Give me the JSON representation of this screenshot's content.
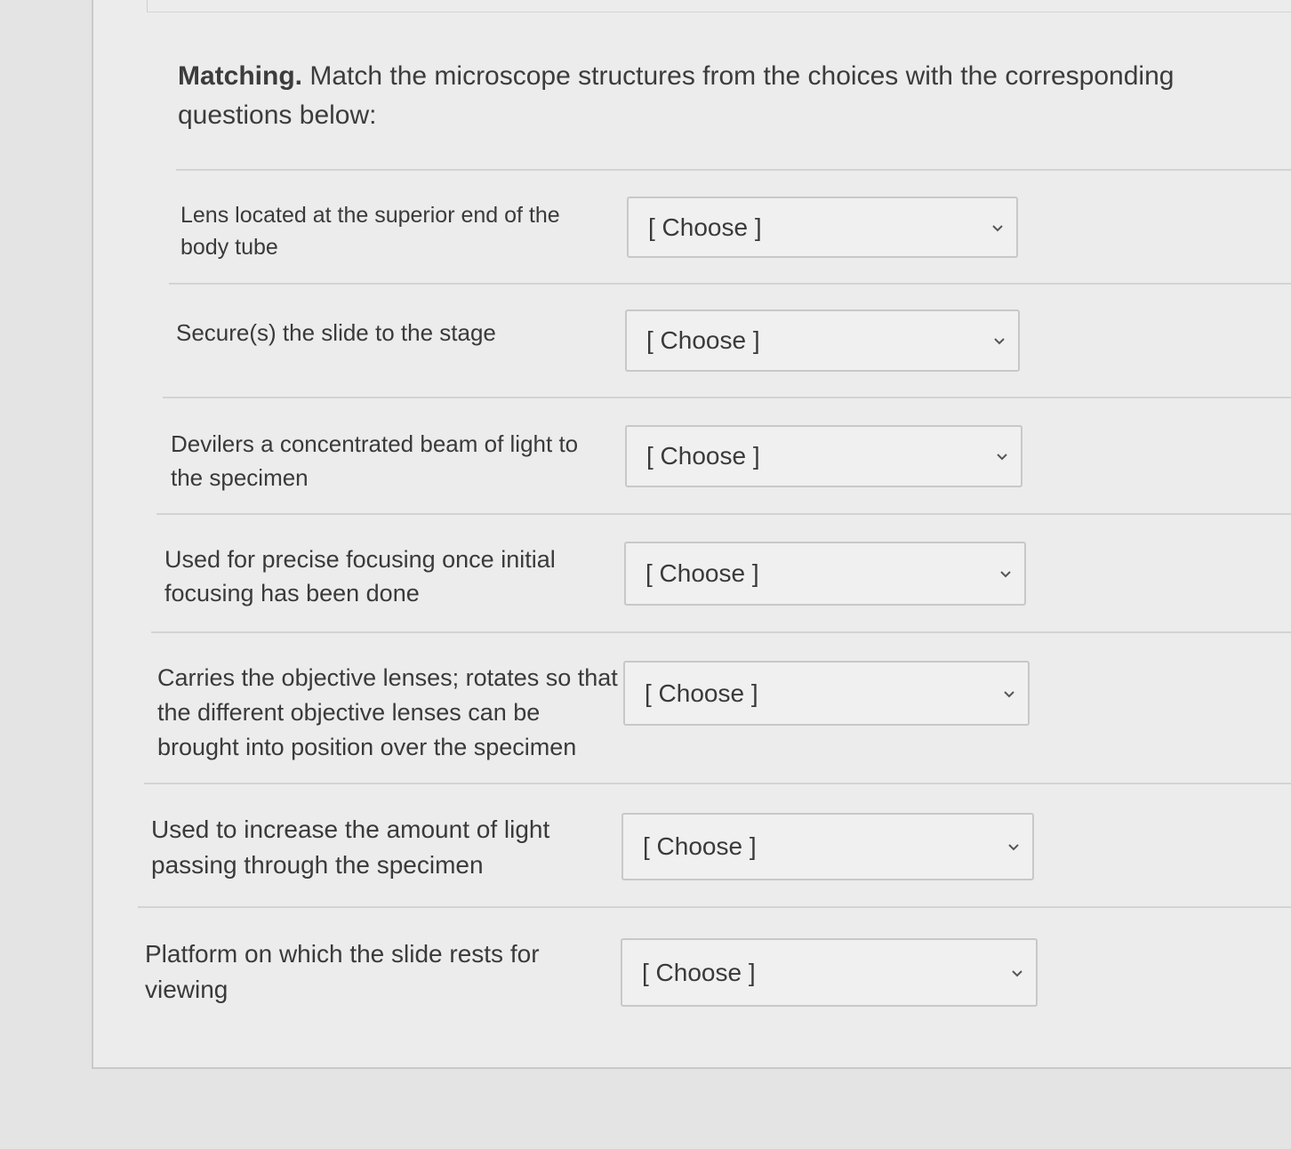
{
  "header": {
    "bold_label": "Matching.",
    "instructions": "Match the microscope structures from the choices with the corresponding questions below:"
  },
  "select_placeholder": "[ Choose ]",
  "questions": [
    {
      "text": "Lens located at the superior end of the body tube",
      "selected": "[ Choose ]"
    },
    {
      "text": "Secure(s) the slide to the stage",
      "selected": "[ Choose ]"
    },
    {
      "text": "Devilers a concentrated beam of light to the specimen",
      "selected": "[ Choose ]"
    },
    {
      "text": "Used for precise focusing once initial focusing has been done",
      "selected": "[ Choose ]"
    },
    {
      "text": "Carries the objective lenses; rotates so that the different objective lenses can be brought into position over the specimen",
      "selected": "[ Choose ]"
    },
    {
      "text": "Used to increase the amount of light passing through the specimen",
      "selected": "[ Choose ]"
    },
    {
      "text": "Platform on which the slide rests for viewing",
      "selected": "[ Choose ]"
    }
  ],
  "icons": {
    "dropdown": "chevron-down-icon"
  }
}
